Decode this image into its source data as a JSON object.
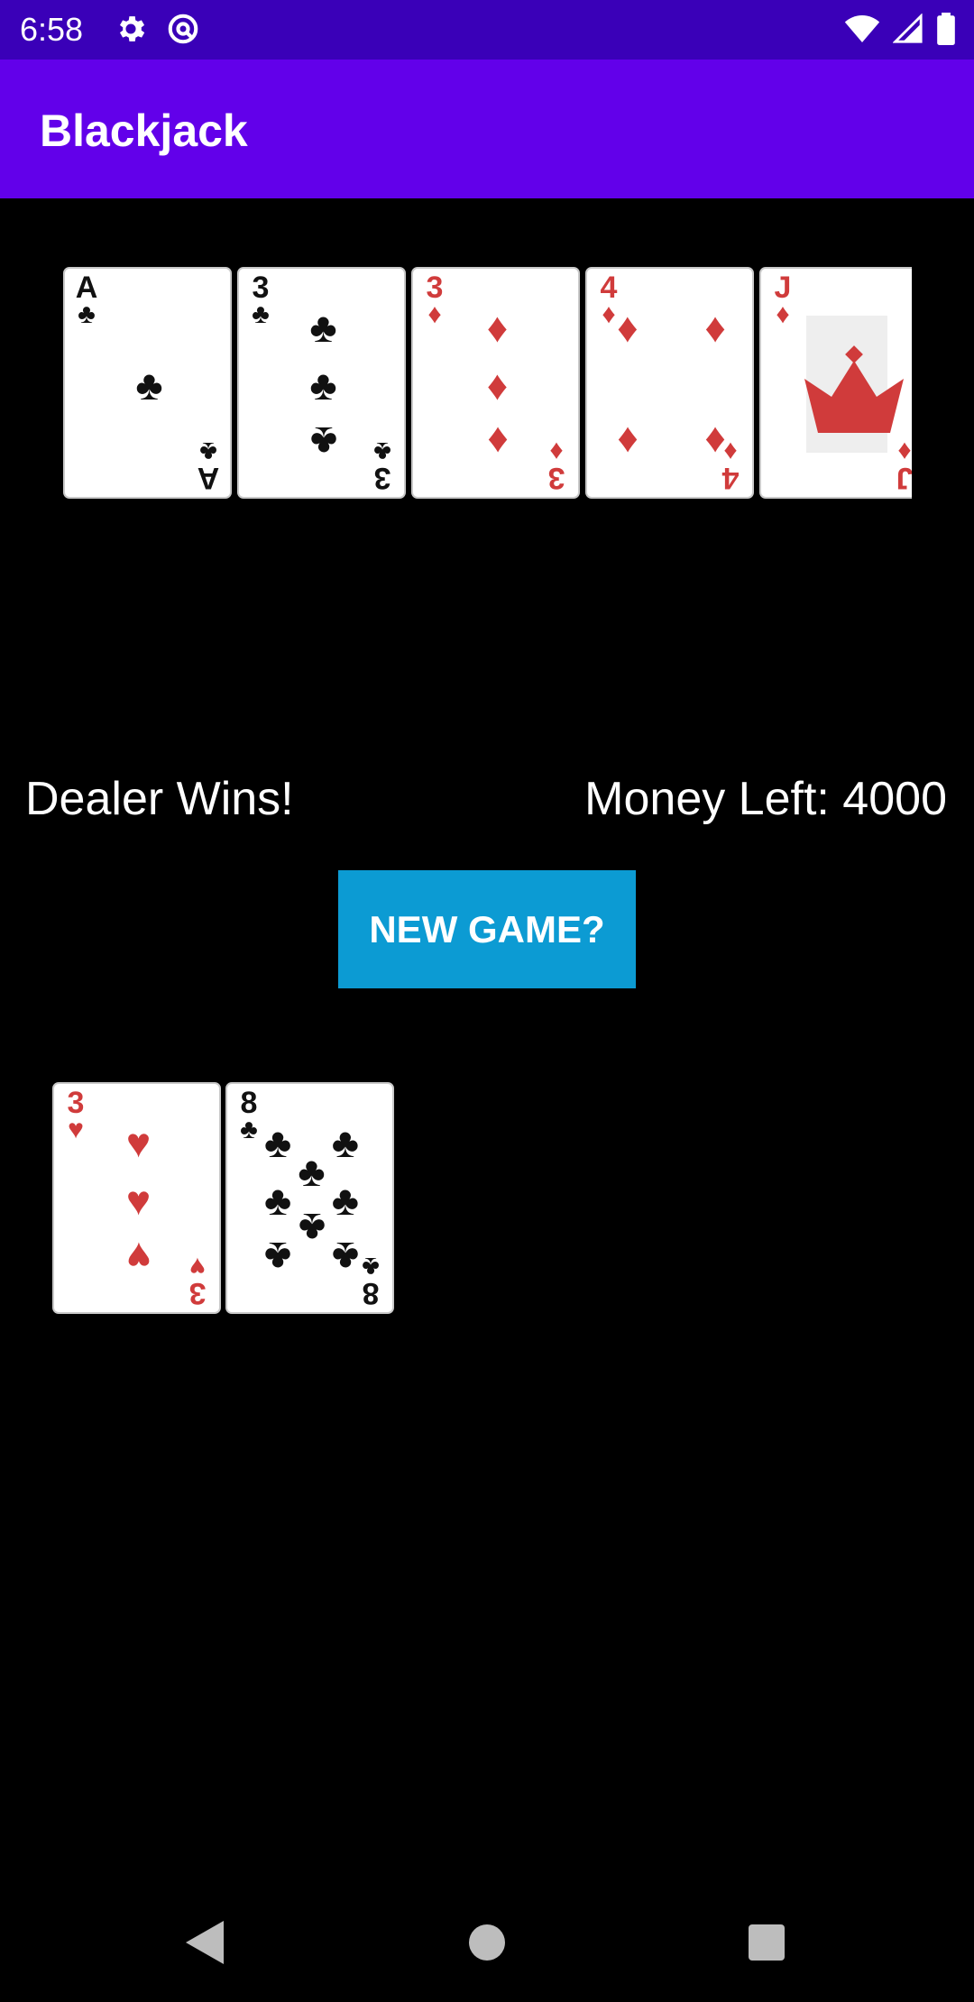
{
  "status_bar": {
    "time": "6:58",
    "left_icons": [
      "gear-icon",
      "at-sign-icon"
    ],
    "right_icons": [
      "wifi-icon",
      "signal-icon",
      "battery-icon"
    ]
  },
  "app_bar": {
    "title": "Blackjack"
  },
  "dealer_hand": {
    "cards": [
      {
        "rank": "A",
        "suit": "♣",
        "color": "black"
      },
      {
        "rank": "3",
        "suit": "♣",
        "color": "black"
      },
      {
        "rank": "3",
        "suit": "♦",
        "color": "red"
      },
      {
        "rank": "4",
        "suit": "♦",
        "color": "red"
      },
      {
        "rank": "J",
        "suit": "♦",
        "color": "red"
      }
    ]
  },
  "game_status": {
    "result": "Dealer Wins!",
    "money_left": "Money Left: 4000"
  },
  "new_game_button": {
    "label": "NEW GAME?"
  },
  "player_hand": {
    "cards": [
      {
        "rank": "3",
        "suit": "♥",
        "color": "red"
      },
      {
        "rank": "8",
        "suit": "♣",
        "color": "black"
      }
    ]
  },
  "nav_bar": {
    "buttons": [
      "back-icon",
      "home-icon",
      "recents-icon"
    ]
  },
  "colors": {
    "status_bar": "#3a00b8",
    "app_bar": "#6200ea",
    "background": "#000000",
    "button": "#0c9bd3",
    "red_suit": "#d03b3b"
  }
}
